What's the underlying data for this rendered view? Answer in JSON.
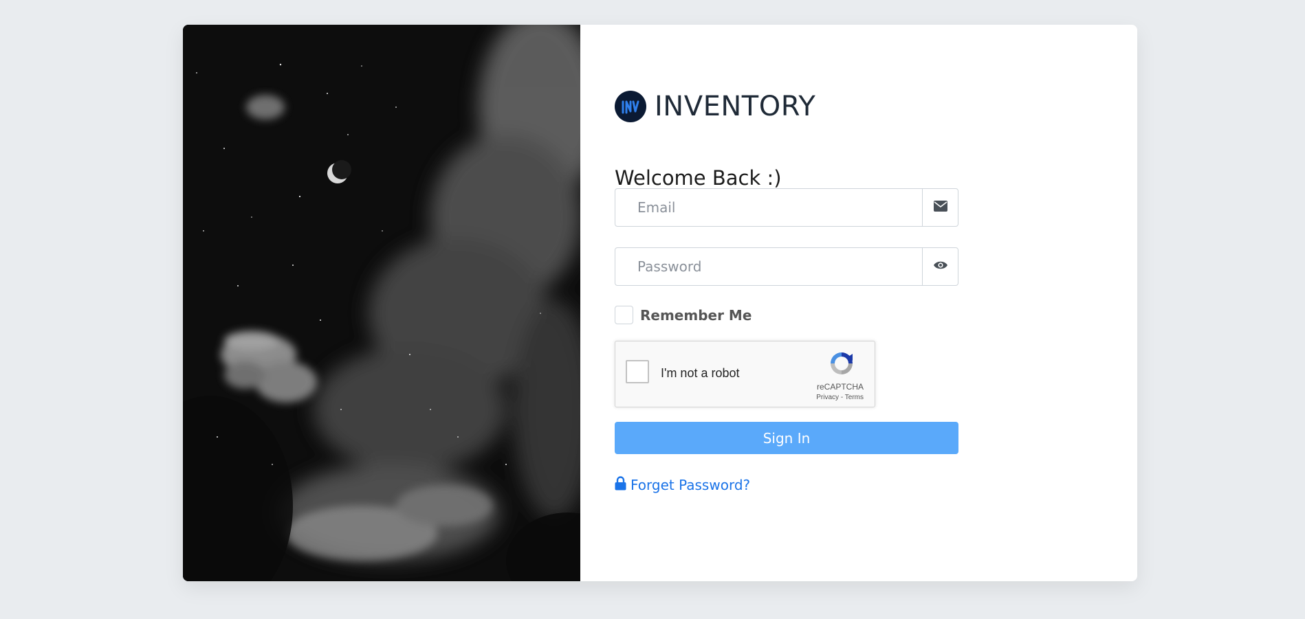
{
  "brand": {
    "name": "INVENTORY",
    "logo_icon": "inventory-logo-icon",
    "logo_color": "#0b1a33",
    "logo_accent": "#2f80ed"
  },
  "welcome_text": "Welcome Back :)",
  "email": {
    "placeholder": "Email",
    "value": "",
    "icon": "envelope-icon"
  },
  "password": {
    "placeholder": "Password",
    "value": "",
    "icon": "eye-icon"
  },
  "remember_me": {
    "label": "Remember Me",
    "checked": false
  },
  "recaptcha": {
    "label": "I'm not a robot",
    "brand": "reCAPTCHA",
    "privacy": "Privacy",
    "separator": " - ",
    "terms": "Terms"
  },
  "sign_in": {
    "label": "Sign In",
    "color": "#5aa9fa"
  },
  "forgot_password": {
    "label": "Forget Password?",
    "icon": "lock-icon",
    "color": "#1a73e8"
  }
}
